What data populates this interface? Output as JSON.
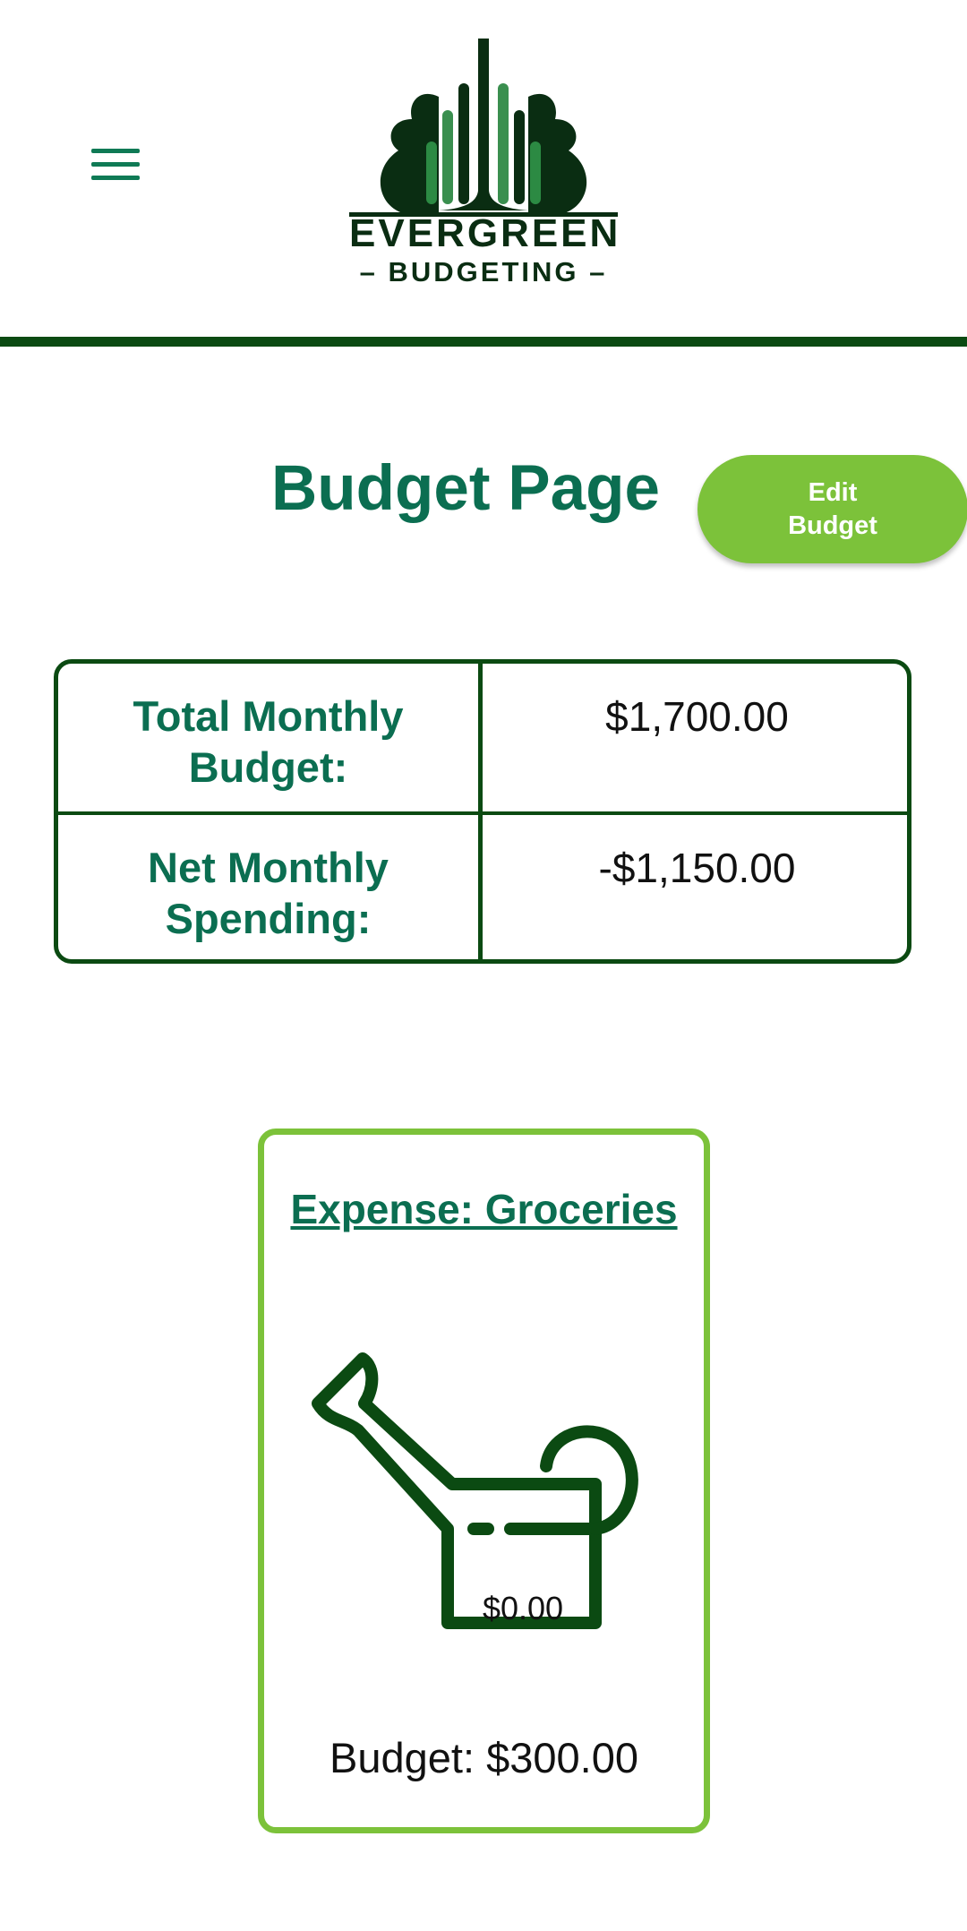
{
  "header": {
    "logo_title": "EVERGREEN",
    "logo_subtitle": "– BUDGETING –"
  },
  "page": {
    "title": "Budget Page",
    "edit_button": "Edit Budget"
  },
  "summary": {
    "rows": [
      {
        "label": "Total Monthly Budget:",
        "value": "$1,700.00"
      },
      {
        "label": "Net Monthly Spending:",
        "value": "-$1,150.00"
      }
    ]
  },
  "expense_card": {
    "title": "Expense: Groceries",
    "spent": "$0.00",
    "budget": "Budget: $300.00",
    "icon": "watering-can-icon"
  },
  "colors": {
    "primary_dark": "#0b4a12",
    "primary_text": "#0b6e51",
    "accent": "#7cc23a"
  }
}
